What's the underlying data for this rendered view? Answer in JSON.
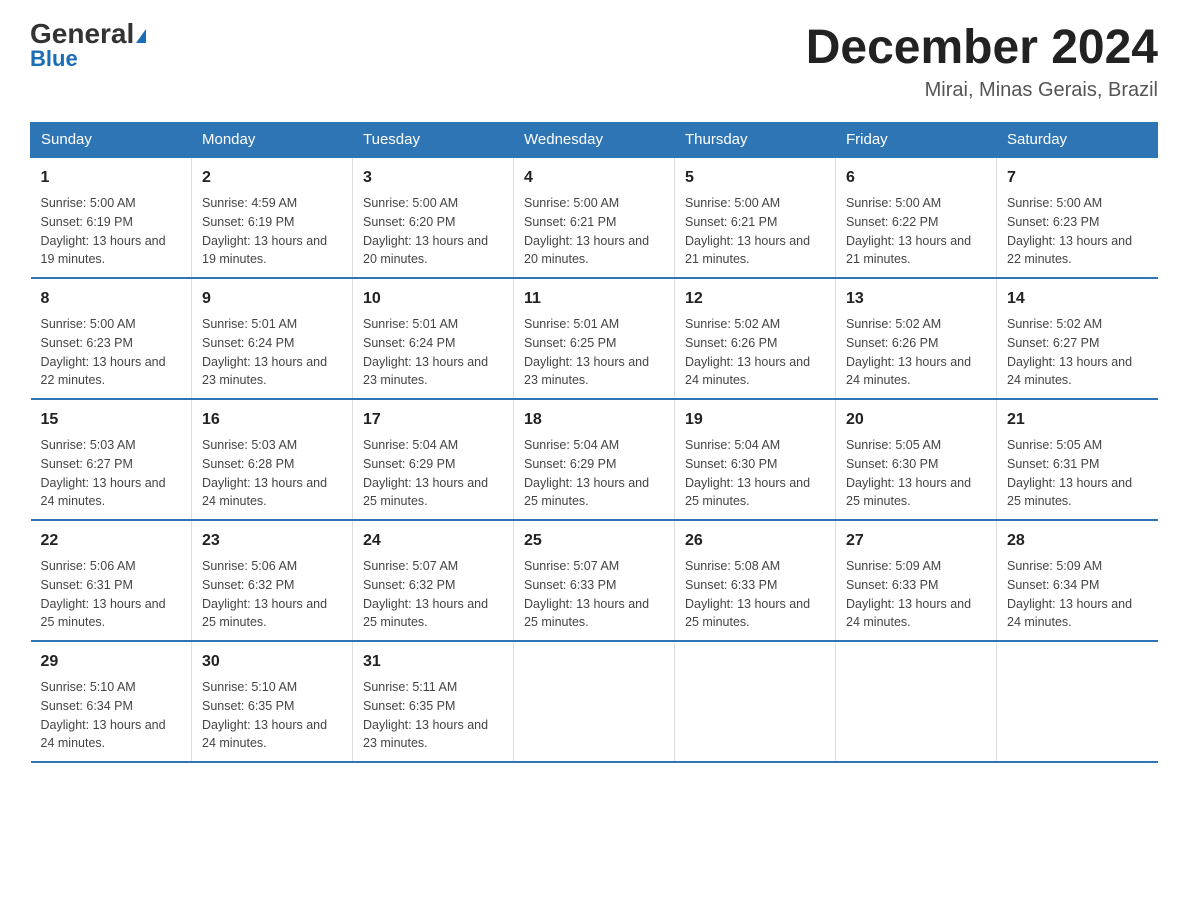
{
  "header": {
    "logo_general": "General",
    "logo_blue": "Blue",
    "month_title": "December 2024",
    "location": "Mirai, Minas Gerais, Brazil"
  },
  "weekdays": [
    "Sunday",
    "Monday",
    "Tuesday",
    "Wednesday",
    "Thursday",
    "Friday",
    "Saturday"
  ],
  "weeks": [
    [
      {
        "day": "1",
        "sunrise": "5:00 AM",
        "sunset": "6:19 PM",
        "daylight": "13 hours and 19 minutes."
      },
      {
        "day": "2",
        "sunrise": "4:59 AM",
        "sunset": "6:19 PM",
        "daylight": "13 hours and 19 minutes."
      },
      {
        "day": "3",
        "sunrise": "5:00 AM",
        "sunset": "6:20 PM",
        "daylight": "13 hours and 20 minutes."
      },
      {
        "day": "4",
        "sunrise": "5:00 AM",
        "sunset": "6:21 PM",
        "daylight": "13 hours and 20 minutes."
      },
      {
        "day": "5",
        "sunrise": "5:00 AM",
        "sunset": "6:21 PM",
        "daylight": "13 hours and 21 minutes."
      },
      {
        "day": "6",
        "sunrise": "5:00 AM",
        "sunset": "6:22 PM",
        "daylight": "13 hours and 21 minutes."
      },
      {
        "day": "7",
        "sunrise": "5:00 AM",
        "sunset": "6:23 PM",
        "daylight": "13 hours and 22 minutes."
      }
    ],
    [
      {
        "day": "8",
        "sunrise": "5:00 AM",
        "sunset": "6:23 PM",
        "daylight": "13 hours and 22 minutes."
      },
      {
        "day": "9",
        "sunrise": "5:01 AM",
        "sunset": "6:24 PM",
        "daylight": "13 hours and 23 minutes."
      },
      {
        "day": "10",
        "sunrise": "5:01 AM",
        "sunset": "6:24 PM",
        "daylight": "13 hours and 23 minutes."
      },
      {
        "day": "11",
        "sunrise": "5:01 AM",
        "sunset": "6:25 PM",
        "daylight": "13 hours and 23 minutes."
      },
      {
        "day": "12",
        "sunrise": "5:02 AM",
        "sunset": "6:26 PM",
        "daylight": "13 hours and 24 minutes."
      },
      {
        "day": "13",
        "sunrise": "5:02 AM",
        "sunset": "6:26 PM",
        "daylight": "13 hours and 24 minutes."
      },
      {
        "day": "14",
        "sunrise": "5:02 AM",
        "sunset": "6:27 PM",
        "daylight": "13 hours and 24 minutes."
      }
    ],
    [
      {
        "day": "15",
        "sunrise": "5:03 AM",
        "sunset": "6:27 PM",
        "daylight": "13 hours and 24 minutes."
      },
      {
        "day": "16",
        "sunrise": "5:03 AM",
        "sunset": "6:28 PM",
        "daylight": "13 hours and 24 minutes."
      },
      {
        "day": "17",
        "sunrise": "5:04 AM",
        "sunset": "6:29 PM",
        "daylight": "13 hours and 25 minutes."
      },
      {
        "day": "18",
        "sunrise": "5:04 AM",
        "sunset": "6:29 PM",
        "daylight": "13 hours and 25 minutes."
      },
      {
        "day": "19",
        "sunrise": "5:04 AM",
        "sunset": "6:30 PM",
        "daylight": "13 hours and 25 minutes."
      },
      {
        "day": "20",
        "sunrise": "5:05 AM",
        "sunset": "6:30 PM",
        "daylight": "13 hours and 25 minutes."
      },
      {
        "day": "21",
        "sunrise": "5:05 AM",
        "sunset": "6:31 PM",
        "daylight": "13 hours and 25 minutes."
      }
    ],
    [
      {
        "day": "22",
        "sunrise": "5:06 AM",
        "sunset": "6:31 PM",
        "daylight": "13 hours and 25 minutes."
      },
      {
        "day": "23",
        "sunrise": "5:06 AM",
        "sunset": "6:32 PM",
        "daylight": "13 hours and 25 minutes."
      },
      {
        "day": "24",
        "sunrise": "5:07 AM",
        "sunset": "6:32 PM",
        "daylight": "13 hours and 25 minutes."
      },
      {
        "day": "25",
        "sunrise": "5:07 AM",
        "sunset": "6:33 PM",
        "daylight": "13 hours and 25 minutes."
      },
      {
        "day": "26",
        "sunrise": "5:08 AM",
        "sunset": "6:33 PM",
        "daylight": "13 hours and 25 minutes."
      },
      {
        "day": "27",
        "sunrise": "5:09 AM",
        "sunset": "6:33 PM",
        "daylight": "13 hours and 24 minutes."
      },
      {
        "day": "28",
        "sunrise": "5:09 AM",
        "sunset": "6:34 PM",
        "daylight": "13 hours and 24 minutes."
      }
    ],
    [
      {
        "day": "29",
        "sunrise": "5:10 AM",
        "sunset": "6:34 PM",
        "daylight": "13 hours and 24 minutes."
      },
      {
        "day": "30",
        "sunrise": "5:10 AM",
        "sunset": "6:35 PM",
        "daylight": "13 hours and 24 minutes."
      },
      {
        "day": "31",
        "sunrise": "5:11 AM",
        "sunset": "6:35 PM",
        "daylight": "13 hours and 23 minutes."
      },
      null,
      null,
      null,
      null
    ]
  ]
}
